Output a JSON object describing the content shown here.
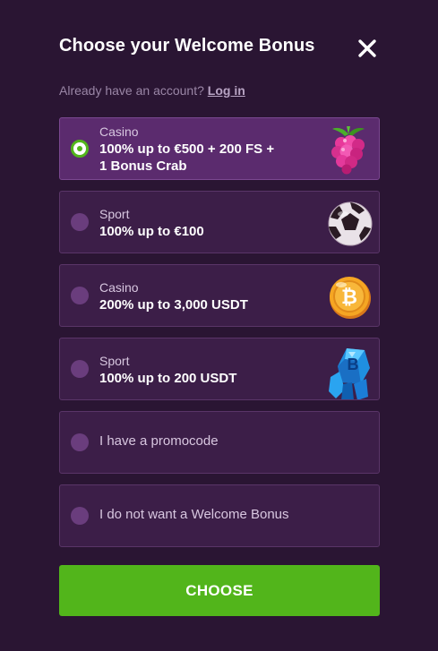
{
  "header": {
    "title": "Choose your Welcome Bonus",
    "close_icon": "close-icon"
  },
  "account": {
    "prompt": "Already have an account?",
    "login_label": "Log in"
  },
  "options": [
    {
      "category": "Casino",
      "offer_line1": "100% up to €500 + 200 FS +",
      "offer_line2": "1 Bonus Crab",
      "icon": "raspberry-icon",
      "selected": true
    },
    {
      "category": "Sport",
      "offer_line1": "100% up to €100",
      "icon": "soccer-ball-icon",
      "selected": false
    },
    {
      "category": "Casino",
      "offer_line1": "200% up to 3,000 USDT",
      "icon": "bitcoin-coin-icon",
      "selected": false
    },
    {
      "category": "Sport",
      "offer_line1": "100% up to 200 USDT",
      "icon": "bitcoin-crystal-icon",
      "selected": false
    },
    {
      "label": "I have a promocode",
      "selected": false
    },
    {
      "label": "I do not want a Welcome Bonus",
      "selected": false
    }
  ],
  "actions": {
    "choose_label": "CHOOSE"
  },
  "colors": {
    "background": "#2a1533",
    "option_bg": "#3c1e48",
    "option_selected_bg": "#5b2b6e",
    "accent_green": "#52b51b"
  }
}
